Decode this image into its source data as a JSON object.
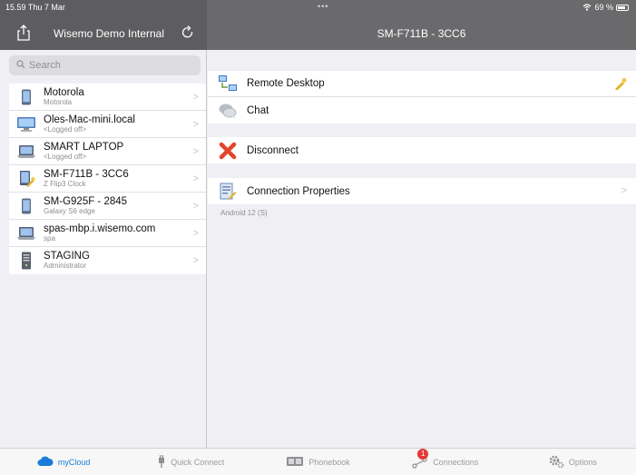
{
  "status_bar": {
    "time": "15.59",
    "date": "Thu 7 Mar",
    "dots": "•••",
    "battery": "69 %"
  },
  "left_header": {
    "title": "Wisemo Demo Internal"
  },
  "right_header": {
    "title": "SM-F711B - 3CC6"
  },
  "search": {
    "placeholder": "Search"
  },
  "devices": [
    {
      "name": "Motorola",
      "sub": "Motorola",
      "icon": "phone-icon"
    },
    {
      "name": "Oles-Mac-mini.local",
      "sub": "<Logged off>",
      "icon": "monitor-icon"
    },
    {
      "name": "SMART LAPTOP",
      "sub": "<Logged off>",
      "icon": "laptop-icon"
    },
    {
      "name": "SM-F711B - 3CC6",
      "sub": "Z Flip3 Clock",
      "icon": "phone-key-icon"
    },
    {
      "name": "SM-G925F - 2845",
      "sub": "Galaxy S6 edge",
      "icon": "phone-icon"
    },
    {
      "name": "spas-mbp.i.wisemo.com",
      "sub": "spa",
      "icon": "laptop-icon"
    },
    {
      "name": "STAGING",
      "sub": "Administrator",
      "icon": "server-icon"
    }
  ],
  "actions": {
    "remote_desktop": "Remote Desktop",
    "chat": "Chat",
    "disconnect": "Disconnect",
    "connection_properties": "Connection Properties"
  },
  "footnote": "Android 12 (S)",
  "tabs": {
    "mycloud": "myCloud",
    "quick_connect": "Quick Connect",
    "phonebook": "Phonebook",
    "connections": "Connections",
    "connections_badge": "1",
    "options": "Options"
  },
  "colors": {
    "header": "#5d5d60",
    "accent": "#1a7cd8",
    "badge": "#e53935"
  }
}
